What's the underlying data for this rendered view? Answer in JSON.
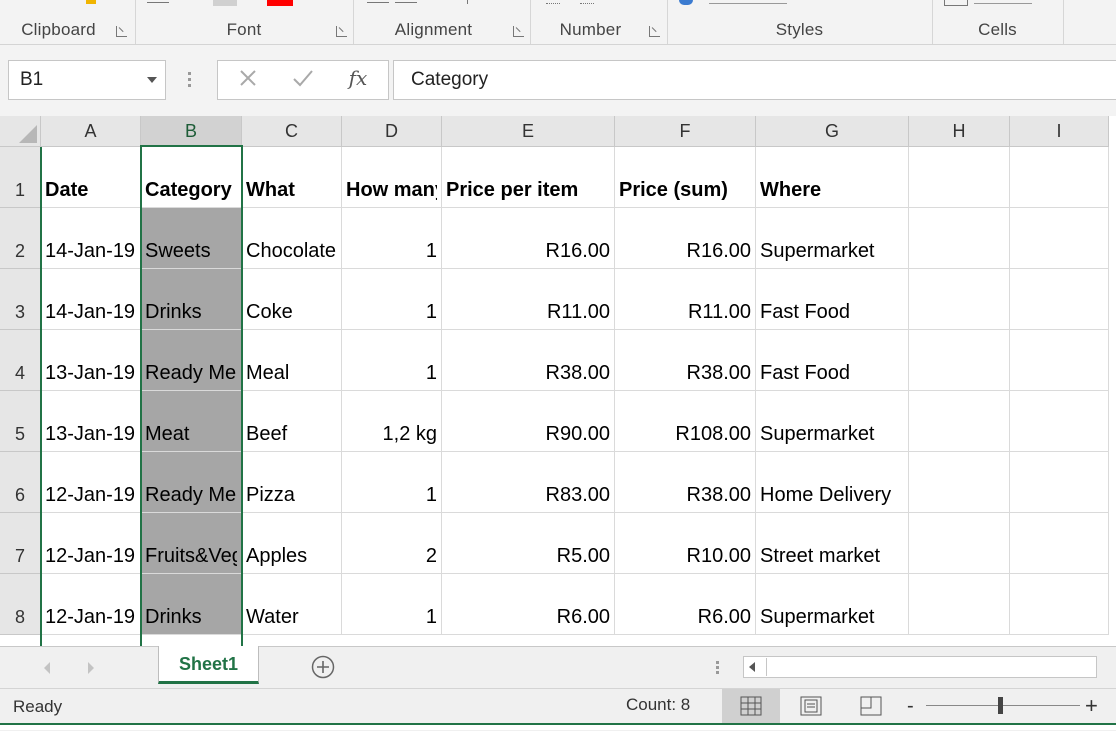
{
  "ribbon": {
    "groups": [
      {
        "name": "clipboard",
        "label": "Clipboard"
      },
      {
        "name": "font",
        "label": "Font"
      },
      {
        "name": "alignment",
        "label": "Alignment"
      },
      {
        "name": "number",
        "label": "Number"
      },
      {
        "name": "styles",
        "label": "Styles"
      },
      {
        "name": "cells",
        "label": "Cells"
      }
    ],
    "font_color": "#ff0000",
    "brand_color": "#217346"
  },
  "formula_bar": {
    "name_box": "B1",
    "cancel_icon": "x-icon",
    "enter_icon": "check-icon",
    "function_icon": "fx-icon",
    "function_label": "fx",
    "content": "Category"
  },
  "grid": {
    "columns": [
      "A",
      "B",
      "C",
      "D",
      "E",
      "F",
      "G",
      "H",
      "I"
    ],
    "selected_column": "B",
    "active_cell": "B1",
    "rows": [
      {
        "num": "1",
        "cells": [
          "Date",
          "Category",
          "What",
          "How many",
          "Price per item",
          "Price (sum)",
          "Where",
          "",
          ""
        ]
      },
      {
        "num": "2",
        "cells": [
          "14-Jan-19",
          "Sweets",
          "Chocolate",
          "1",
          "R16.00",
          "R16.00",
          "Supermarket",
          "",
          ""
        ]
      },
      {
        "num": "3",
        "cells": [
          "14-Jan-19",
          "Drinks",
          "Coke",
          "1",
          "R11.00",
          "R11.00",
          "Fast Food",
          "",
          ""
        ]
      },
      {
        "num": "4",
        "cells": [
          "13-Jan-19",
          "Ready Meals",
          "Meal",
          "1",
          "R38.00",
          "R38.00",
          "Fast Food",
          "",
          ""
        ]
      },
      {
        "num": "5",
        "cells": [
          "13-Jan-19",
          "Meat",
          "Beef",
          "1,2 kg",
          "R90.00",
          "R108.00",
          "Supermarket",
          "",
          ""
        ]
      },
      {
        "num": "6",
        "cells": [
          "12-Jan-19",
          "Ready Meals",
          "Pizza",
          "1",
          "R83.00",
          "R38.00",
          "Home Delivery",
          "",
          ""
        ]
      },
      {
        "num": "7",
        "cells": [
          "12-Jan-19",
          "Fruits&Veg",
          "Apples",
          "2",
          "R5.00",
          "R10.00",
          "Street market",
          "",
          ""
        ]
      },
      {
        "num": "8",
        "cells": [
          "12-Jan-19",
          "Drinks",
          "Water",
          "1",
          "R6.00",
          "R6.00",
          "Supermarket",
          "",
          ""
        ]
      }
    ]
  },
  "sheet_tabs": {
    "tabs": [
      "Sheet1"
    ],
    "add_icon": "plus-circle-icon"
  },
  "status_bar": {
    "ready": "Ready",
    "count": "Count: 8",
    "views": [
      "normal-view-icon",
      "page-layout-icon",
      "page-break-preview-icon"
    ],
    "zoom_minus": "-",
    "zoom_plus": "+"
  }
}
